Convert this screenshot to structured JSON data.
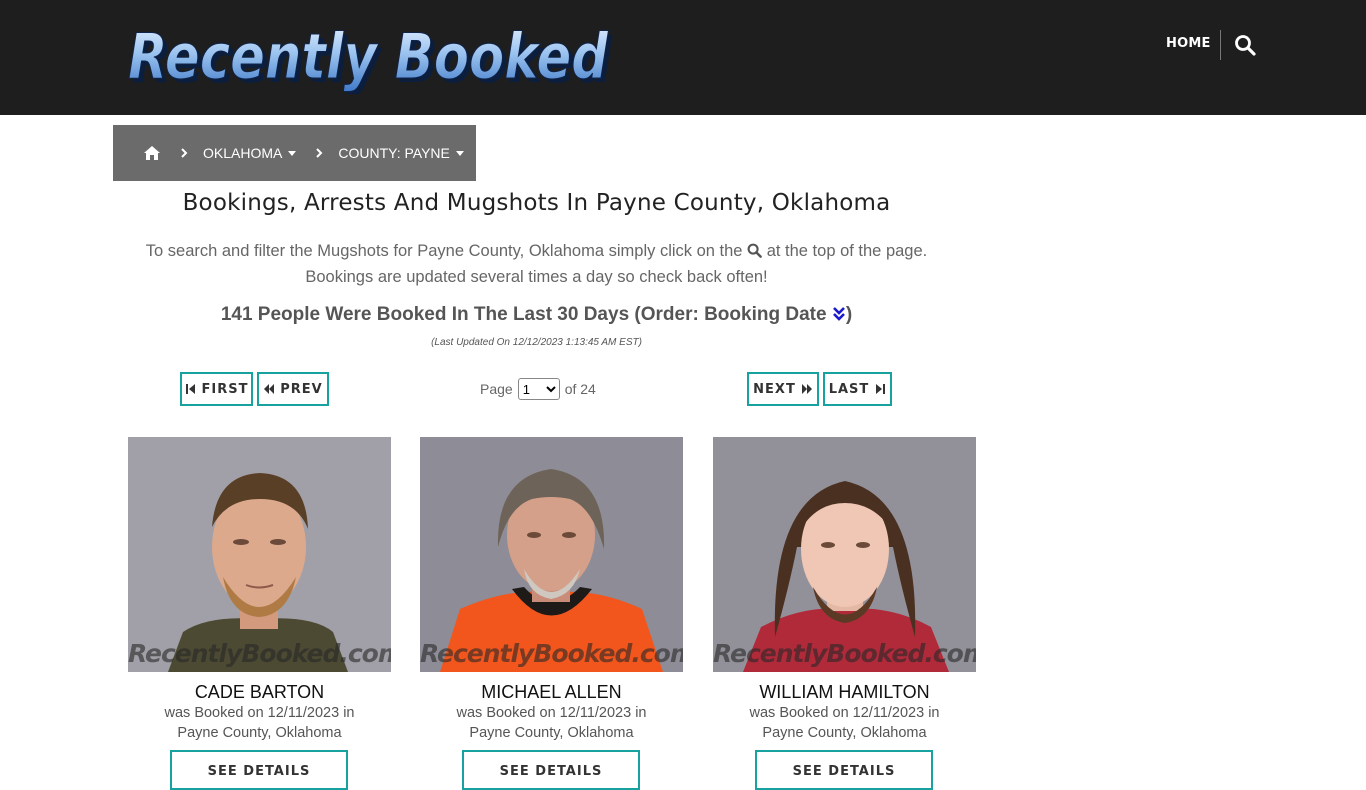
{
  "header": {
    "logo_text": "Recently Booked",
    "nav_home": "HOME",
    "search_icon": "search-icon"
  },
  "breadcrumb": {
    "home_icon": "home-icon",
    "state": "OKLAHOMA",
    "county": "COUNTY: PAYNE"
  },
  "main": {
    "title": "Bookings, Arrests And Mugshots In Payne County, Oklahoma",
    "desc_before": "To search and filter the Mugshots for Payne County, Oklahoma simply click on the",
    "desc_after": "at the top of the page.",
    "desc_line2": "Bookings are updated several times a day so check back often!",
    "count_text": "141 People Were Booked In The Last 30 Days (Order: Booking Date",
    "count_close": ")",
    "last_updated": "(Last Updated On 12/12/2023 1:13:45 AM EST)"
  },
  "pagination": {
    "first": "FIRST",
    "prev": "PREV",
    "next": "NEXT",
    "last": "LAST",
    "page_label": "Page",
    "current_page": "1",
    "of_label": "of 24"
  },
  "bookings": [
    {
      "name": "CADE BARTON",
      "booked_line": "was Booked on 12/11/2023 in",
      "location": "Payne County, Oklahoma",
      "watermark": "RecentlyBooked.com",
      "button": "SEE DETAILS"
    },
    {
      "name": "MICHAEL ALLEN",
      "booked_line": "was Booked on 12/11/2023 in",
      "location": "Payne County, Oklahoma",
      "watermark": "RecentlyBooked.com",
      "button": "SEE DETAILS"
    },
    {
      "name": "WILLIAM HAMILTON",
      "booked_line": "was Booked on 12/11/2023 in",
      "location": "Payne County, Oklahoma",
      "watermark": "RecentlyBooked.com",
      "button": "SEE DETAILS"
    }
  ],
  "colors": {
    "header_bg": "#1e1e1e",
    "breadcrumb_bg": "#6b6b6b",
    "accent": "#17a2a0",
    "order_icon": "#1a1acc"
  }
}
